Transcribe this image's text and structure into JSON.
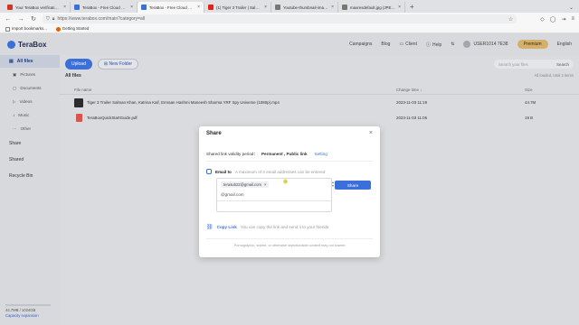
{
  "browser": {
    "tabs": [
      {
        "label": "Your TeraBox verification code",
        "color": "#d93025"
      },
      {
        "label": "TeraBox - Free Cloud Storage Up...",
        "color": "#3b6fd9"
      },
      {
        "label": "TeraBox - Free Cloud Storage Up...",
        "color": "#3b6fd9",
        "active": true
      },
      {
        "label": "(1) Tiger 3 Trailer | Salman Khan...",
        "color": "#e62117"
      },
      {
        "label": "Youtube-thumbnail-image-Vie...",
        "color": "#555555"
      },
      {
        "label": "maxresdefault.jpg (JPEG Image, 12...",
        "color": "#555555"
      }
    ],
    "new_tab": "+",
    "url": "https://www.terabox.com/main?category=all",
    "bookmarks": [
      "Import bookmarks...",
      "Getting Started"
    ]
  },
  "app": {
    "logo": "TeraBox",
    "topnav": {
      "campaigns": "Campaigns",
      "blog": "Blog",
      "client": "Client",
      "help": "Help",
      "username": "USER1014 7E38",
      "premium": "Premium",
      "language": "English"
    },
    "sidebar": {
      "all_files": "All files",
      "items": [
        "Pictures",
        "Documents",
        "Videos",
        "Music",
        "Other"
      ],
      "share": "Share",
      "shared": "Shared",
      "recycle": "Recycle Bin",
      "storage_used": "44.7MB / 1024GB",
      "capacity": "Capacity expansion"
    },
    "main": {
      "upload": "Upload",
      "new_folder": "New Folder",
      "search_placeholder": "Search your files",
      "search_button": "Search",
      "section_title": "All files",
      "meta": "All loaded, total 2 items",
      "columns": {
        "name": "File name",
        "time": "Change time",
        "size": "Size"
      },
      "files": [
        {
          "name": "Tiger 3 Trailer Salman Khan, Katrina Kaif, Emraan Hashmi Maneesh Sharma YRF Spy Universe (1080p).mp4",
          "time": "2023-11-03 11:19",
          "size": "44.7M"
        },
        {
          "name": "TeraBoxQuickStartGuide.pdf",
          "time": "2023-11-03 11:05",
          "size": "19 B"
        }
      ]
    }
  },
  "modal": {
    "title": "Share",
    "validity_label": "Shared link validity period：",
    "validity_value": "Permanent , Public link",
    "setting": "Setting",
    "email_to": "Email to",
    "email_hint": "A maximum of 3 email addresses can be entered",
    "chip_email": "terasub22@gmail.com",
    "email_input": "@gmail.com",
    "share_button": "Share",
    "copy_link": "Copy Link",
    "copy_hint": "You can copy the link and send it to your friends",
    "footer": "Pornographic, violent, or otherwise objectionable content may not shared"
  }
}
